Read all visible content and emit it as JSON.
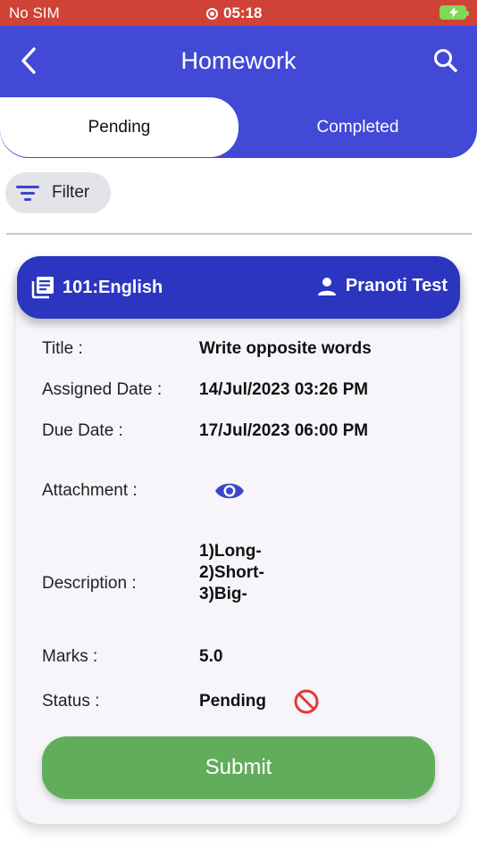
{
  "status_bar": {
    "carrier": "No SIM",
    "time": "05:18"
  },
  "header": {
    "title": "Homework"
  },
  "tabs": [
    {
      "label": "Pending",
      "active": true
    },
    {
      "label": "Completed",
      "active": false
    }
  ],
  "filter": {
    "label": "Filter"
  },
  "card": {
    "subject": "101:English",
    "teacher": "Pranoti Test",
    "fields": {
      "title_label": "Title :",
      "title_value": "Write opposite words",
      "assigned_label": "Assigned Date :",
      "assigned_value": "14/Jul/2023 03:26 PM",
      "due_label": "Due Date :",
      "due_value": "17/Jul/2023 06:00 PM",
      "attachment_label": "Attachment :",
      "description_label": "Description :",
      "description_lines": [
        "1)Long-",
        "2)Short-",
        "3)Big-"
      ],
      "marks_label": "Marks :",
      "marks_value": "5.0",
      "status_label": "Status :",
      "status_value": "Pending"
    },
    "submit_label": "Submit"
  },
  "colors": {
    "primary": "#4149d6",
    "card_header": "#2b35c0",
    "submit": "#61ad5b",
    "status_bar": "#d14236",
    "status_icon": "#e53935"
  }
}
